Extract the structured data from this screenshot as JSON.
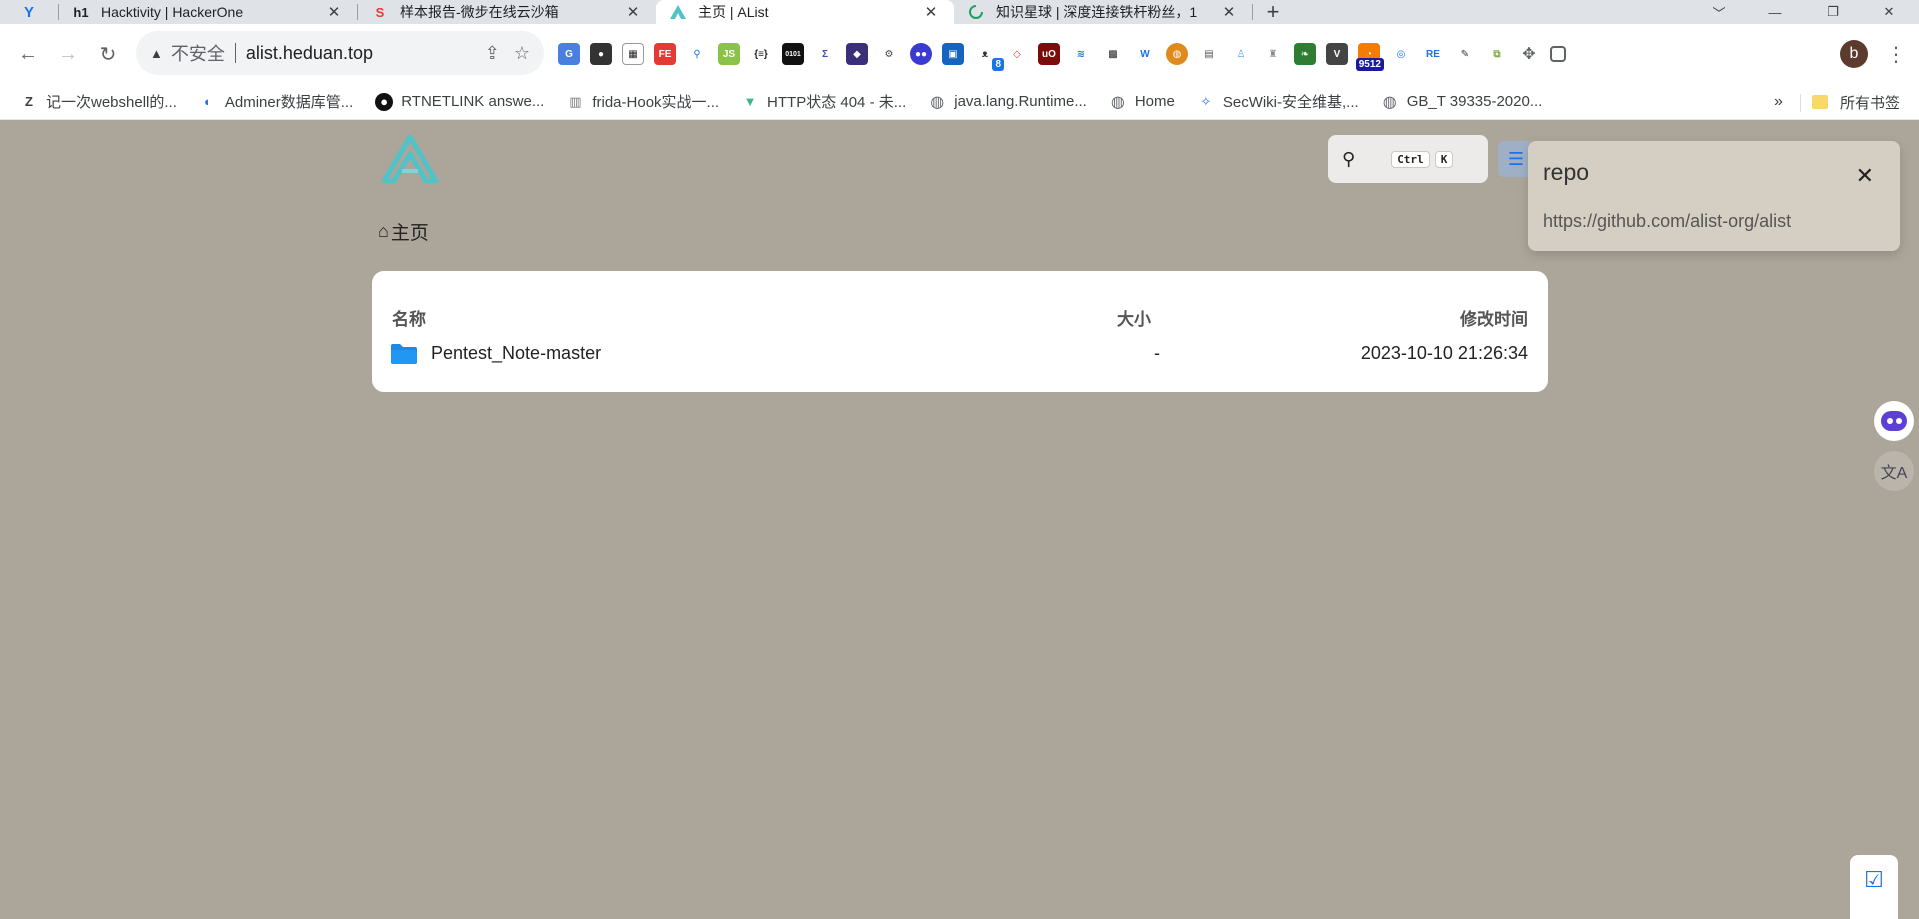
{
  "tabs": [
    {
      "title": "Hacktivity | HackerOne",
      "favicon": "h1"
    },
    {
      "title": "样本报告-微步在线云沙箱",
      "favicon": "S"
    },
    {
      "title": "主页 | AList",
      "favicon": "alist-icon",
      "active": true
    },
    {
      "title": "知识星球 | 深度连接铁杆粉丝，1",
      "favicon": "loading-ring"
    }
  ],
  "address_bar": {
    "security_label": "不安全",
    "url": "alist.heduan.top"
  },
  "extensions": {
    "badge_1": "8",
    "badge_2": "9512",
    "profile_initial": "b"
  },
  "bookmarks": [
    {
      "label": "记一次webshell的...",
      "icon": "Z"
    },
    {
      "label": "Adminer数据库管...",
      "icon": "adminer"
    },
    {
      "label": "RTNETLINK answe...",
      "icon": "github"
    },
    {
      "label": "frida-Hook实战一...",
      "icon": "frida"
    },
    {
      "label": "HTTP状态 404 - 未...",
      "icon": "vue"
    },
    {
      "label": "java.lang.Runtime...",
      "icon": "globe"
    },
    {
      "label": "Home",
      "icon": "globe"
    },
    {
      "label": "SecWiki-安全维基,...",
      "icon": "secwiki"
    },
    {
      "label": "GB_T 39335-2020...",
      "icon": "globe"
    }
  ],
  "bookmarks_more": "»",
  "all_bookmarks": "所有书签",
  "page": {
    "search": {
      "key1": "Ctrl",
      "key2": "K"
    },
    "breadcrumb": "主页",
    "table": {
      "col_name": "名称",
      "col_size": "大小",
      "col_modified": "修改时间",
      "rows": [
        {
          "name": "Pentest_Note-master",
          "size": "-",
          "modified": "2023-10-10 21:26:34"
        }
      ]
    },
    "notification": {
      "title": "repo",
      "body": "https://github.com/alist-org/alist"
    }
  },
  "colors": {
    "page_bg": "#aca59a",
    "accent": "#1a73e8",
    "logo": "#4fc3c8"
  }
}
